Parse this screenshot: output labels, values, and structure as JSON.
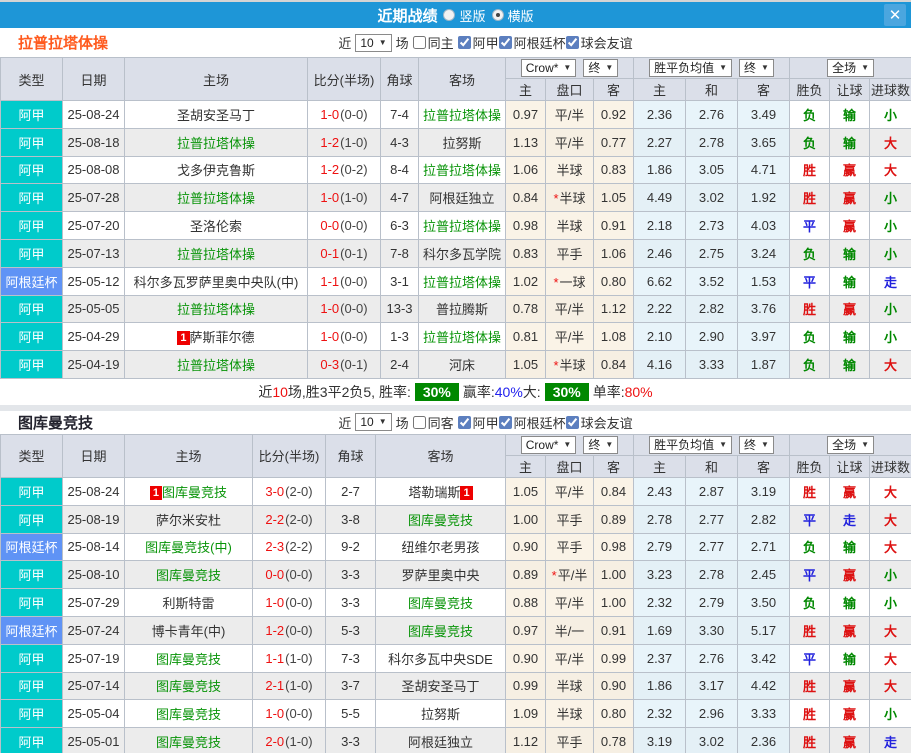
{
  "titlebar": {
    "title": "近期战绩",
    "vertical_label": "竖版",
    "horizontal_label": "横版",
    "horizontal_selected": true,
    "close_glyph": "✕",
    "bar_color": "#1e96d7"
  },
  "table_header": {
    "type": "类型",
    "date": "日期",
    "home": "主场",
    "score": "比分(半场)",
    "corners": "角球",
    "away": "客场",
    "crow_select": "Crow*",
    "final_select": "终",
    "avg_select": "胜平负均值",
    "full_select": "全场",
    "sub_home": "主",
    "sub_handicap": "盘口",
    "sub_away": "客",
    "sub_avg_home": "主",
    "sub_avg_draw": "和",
    "sub_avg_away": "客",
    "sub_result": "胜负",
    "sub_handicap_result": "让球",
    "sub_goals": "进球数"
  },
  "league_colors": {
    "阿甲": "#00cbcb",
    "阿根廷杯": "#5f93f5"
  },
  "sections": [
    {
      "team": "拉普拉塔体操",
      "title_color": "#ff5a1e",
      "filter": {
        "near": "近",
        "count": "10",
        "games": "场",
        "same_label": "同主",
        "same_checked": false,
        "leagues": [
          {
            "label": "阿甲",
            "checked": true
          },
          {
            "label": "阿根廷杯",
            "checked": true
          },
          {
            "label": "球会友谊",
            "checked": true
          }
        ]
      },
      "rows": [
        {
          "league": "阿甲",
          "date": "25-08-24",
          "home": {
            "name": "圣胡安圣马丁"
          },
          "score": "1-0",
          "half": "(0-0)",
          "corners": "7-4",
          "away": {
            "name": "拉普拉塔体操",
            "highlight": true
          },
          "crow": [
            "0.97",
            "平/半",
            "0.92"
          ],
          "crow_star": false,
          "avg": [
            "2.36",
            "2.76",
            "3.49"
          ],
          "results": [
            {
              "t": "负",
              "c": "#008800"
            },
            {
              "t": "输",
              "c": "#008800"
            },
            {
              "t": "小",
              "c": "#008800"
            }
          ]
        },
        {
          "league": "阿甲",
          "date": "25-08-18",
          "home": {
            "name": "拉普拉塔体操",
            "highlight": true
          },
          "score": "1-2",
          "half": "(1-0)",
          "corners": "4-3",
          "away": {
            "name": "拉努斯"
          },
          "crow": [
            "1.13",
            "平/半",
            "0.77"
          ],
          "crow_star": false,
          "avg": [
            "2.27",
            "2.78",
            "3.65"
          ],
          "results": [
            {
              "t": "负",
              "c": "#008800"
            },
            {
              "t": "输",
              "c": "#008800"
            },
            {
              "t": "大",
              "c": "#dd1111"
            }
          ]
        },
        {
          "league": "阿甲",
          "date": "25-08-08",
          "home": {
            "name": "戈多伊克鲁斯"
          },
          "score": "1-2",
          "half": "(0-2)",
          "corners": "8-4",
          "away": {
            "name": "拉普拉塔体操",
            "highlight": true
          },
          "crow": [
            "1.06",
            "半球",
            "0.83"
          ],
          "crow_star": false,
          "avg": [
            "1.86",
            "3.05",
            "4.71"
          ],
          "results": [
            {
              "t": "胜",
              "c": "#dd1111"
            },
            {
              "t": "赢",
              "c": "#dd1111"
            },
            {
              "t": "大",
              "c": "#dd1111"
            }
          ]
        },
        {
          "league": "阿甲",
          "date": "25-07-28",
          "home": {
            "name": "拉普拉塔体操",
            "highlight": true
          },
          "score": "1-0",
          "half": "(1-0)",
          "corners": "4-7",
          "away": {
            "name": "阿根廷独立"
          },
          "crow": [
            "0.84",
            "半球",
            "1.05"
          ],
          "crow_star": true,
          "avg": [
            "4.49",
            "3.02",
            "1.92"
          ],
          "results": [
            {
              "t": "胜",
              "c": "#dd1111"
            },
            {
              "t": "赢",
              "c": "#dd1111"
            },
            {
              "t": "小",
              "c": "#008800"
            }
          ]
        },
        {
          "league": "阿甲",
          "date": "25-07-20",
          "home": {
            "name": "圣洛伦索"
          },
          "score": "0-0",
          "half": "(0-0)",
          "corners": "6-3",
          "away": {
            "name": "拉普拉塔体操",
            "highlight": true
          },
          "crow": [
            "0.98",
            "半球",
            "0.91"
          ],
          "crow_star": false,
          "avg": [
            "2.18",
            "2.73",
            "4.03"
          ],
          "results": [
            {
              "t": "平",
              "c": "#2222dd"
            },
            {
              "t": "赢",
              "c": "#dd1111"
            },
            {
              "t": "小",
              "c": "#008800"
            }
          ]
        },
        {
          "league": "阿甲",
          "date": "25-07-13",
          "home": {
            "name": "拉普拉塔体操",
            "highlight": true
          },
          "score": "0-1",
          "half": "(0-1)",
          "corners": "7-8",
          "away": {
            "name": "科尔多瓦学院"
          },
          "crow": [
            "0.83",
            "平手",
            "1.06"
          ],
          "crow_star": false,
          "avg": [
            "2.46",
            "2.75",
            "3.24"
          ],
          "results": [
            {
              "t": "负",
              "c": "#008800"
            },
            {
              "t": "输",
              "c": "#008800"
            },
            {
              "t": "小",
              "c": "#008800"
            }
          ]
        },
        {
          "league": "阿根廷杯",
          "date": "25-05-12",
          "home": {
            "name": "科尔多瓦罗萨里奥中央队(中)"
          },
          "score": "1-1",
          "half": "(0-0)",
          "corners": "3-1",
          "away": {
            "name": "拉普拉塔体操",
            "highlight": true
          },
          "crow": [
            "1.02",
            "一球",
            "0.80"
          ],
          "crow_star": true,
          "avg": [
            "6.62",
            "3.52",
            "1.53"
          ],
          "results": [
            {
              "t": "平",
              "c": "#2222dd"
            },
            {
              "t": "输",
              "c": "#008800"
            },
            {
              "t": "走",
              "c": "#2222dd"
            }
          ]
        },
        {
          "league": "阿甲",
          "date": "25-05-05",
          "home": {
            "name": "拉普拉塔体操",
            "highlight": true
          },
          "score": "1-0",
          "half": "(0-0)",
          "corners": "13-3",
          "away": {
            "name": "普拉腾斯"
          },
          "crow": [
            "0.78",
            "平/半",
            "1.12"
          ],
          "crow_star": false,
          "avg": [
            "2.22",
            "2.82",
            "3.76"
          ],
          "results": [
            {
              "t": "胜",
              "c": "#dd1111"
            },
            {
              "t": "赢",
              "c": "#dd1111"
            },
            {
              "t": "小",
              "c": "#008800"
            }
          ]
        },
        {
          "league": "阿甲",
          "date": "25-04-29",
          "home": {
            "name": "萨斯菲尔德",
            "badge_before": "1"
          },
          "score": "1-0",
          "half": "(0-0)",
          "corners": "1-3",
          "away": {
            "name": "拉普拉塔体操",
            "highlight": true
          },
          "crow": [
            "0.81",
            "平/半",
            "1.08"
          ],
          "crow_star": false,
          "avg": [
            "2.10",
            "2.90",
            "3.97"
          ],
          "results": [
            {
              "t": "负",
              "c": "#008800"
            },
            {
              "t": "输",
              "c": "#008800"
            },
            {
              "t": "小",
              "c": "#008800"
            }
          ]
        },
        {
          "league": "阿甲",
          "date": "25-04-19",
          "home": {
            "name": "拉普拉塔体操",
            "highlight": true
          },
          "score": "0-3",
          "half": "(0-1)",
          "corners": "2-4",
          "away": {
            "name": "河床"
          },
          "crow": [
            "1.05",
            "半球",
            "0.84"
          ],
          "crow_star": true,
          "avg": [
            "4.16",
            "3.33",
            "1.87"
          ],
          "results": [
            {
              "t": "负",
              "c": "#008800"
            },
            {
              "t": "输",
              "c": "#008800"
            },
            {
              "t": "大",
              "c": "#dd1111"
            }
          ]
        }
      ],
      "summary": {
        "parts": [
          {
            "t": "近",
            "c": "#333333"
          },
          {
            "t": "10",
            "c": "#ee1111"
          },
          {
            "t": "场,胜3平2负5, 胜率: ",
            "c": "#333333"
          },
          {
            "t": "30%",
            "badge": true
          },
          {
            "t": " 赢率:",
            "c": "#333333"
          },
          {
            "t": "40%",
            "c": "#2222ee"
          },
          {
            "t": " 大: ",
            "c": "#333333"
          },
          {
            "t": "30%",
            "badge": true
          },
          {
            "t": " 单率:",
            "c": "#333333"
          },
          {
            "t": "80%",
            "c": "#ee1111"
          }
        ]
      }
    },
    {
      "team": "图库曼竞技",
      "title_color": "#23232e",
      "filter": {
        "near": "近",
        "count": "10",
        "games": "场",
        "same_label": "同客",
        "same_checked": false,
        "leagues": [
          {
            "label": "阿甲",
            "checked": true
          },
          {
            "label": "阿根廷杯",
            "checked": true
          },
          {
            "label": "球会友谊",
            "checked": true
          }
        ]
      },
      "rows": [
        {
          "league": "阿甲",
          "date": "25-08-24",
          "home": {
            "name": "图库曼竞技",
            "highlight": true,
            "badge_before": "1"
          },
          "score": "3-0",
          "half": "(2-0)",
          "corners": "2-7",
          "away": {
            "name": "塔勒瑞斯",
            "badge_after": "1"
          },
          "crow": [
            "1.05",
            "平/半",
            "0.84"
          ],
          "crow_star": false,
          "avg": [
            "2.43",
            "2.87",
            "3.19"
          ],
          "results": [
            {
              "t": "胜",
              "c": "#dd1111"
            },
            {
              "t": "赢",
              "c": "#dd1111"
            },
            {
              "t": "大",
              "c": "#dd1111"
            }
          ]
        },
        {
          "league": "阿甲",
          "date": "25-08-19",
          "home": {
            "name": "萨尔米安杜"
          },
          "score": "2-2",
          "half": "(2-0)",
          "corners": "3-8",
          "away": {
            "name": "图库曼竞技",
            "highlight": true
          },
          "crow": [
            "1.00",
            "平手",
            "0.89"
          ],
          "crow_star": false,
          "avg": [
            "2.78",
            "2.77",
            "2.82"
          ],
          "results": [
            {
              "t": "平",
              "c": "#2222dd"
            },
            {
              "t": "走",
              "c": "#2222dd"
            },
            {
              "t": "大",
              "c": "#dd1111"
            }
          ]
        },
        {
          "league": "阿根廷杯",
          "date": "25-08-14",
          "home": {
            "name": "图库曼竞技(中)",
            "highlight": true
          },
          "score": "2-3",
          "half": "(2-2)",
          "corners": "9-2",
          "away": {
            "name": "纽维尔老男孩"
          },
          "crow": [
            "0.90",
            "平手",
            "0.98"
          ],
          "crow_star": false,
          "avg": [
            "2.79",
            "2.77",
            "2.71"
          ],
          "results": [
            {
              "t": "负",
              "c": "#008800"
            },
            {
              "t": "输",
              "c": "#008800"
            },
            {
              "t": "大",
              "c": "#dd1111"
            }
          ]
        },
        {
          "league": "阿甲",
          "date": "25-08-10",
          "home": {
            "name": "图库曼竞技",
            "highlight": true
          },
          "score": "0-0",
          "half": "(0-0)",
          "corners": "3-3",
          "away": {
            "name": "罗萨里奥中央"
          },
          "crow": [
            "0.89",
            "平/半",
            "1.00"
          ],
          "crow_star": true,
          "avg": [
            "3.23",
            "2.78",
            "2.45"
          ],
          "results": [
            {
              "t": "平",
              "c": "#2222dd"
            },
            {
              "t": "赢",
              "c": "#dd1111"
            },
            {
              "t": "小",
              "c": "#008800"
            }
          ]
        },
        {
          "league": "阿甲",
          "date": "25-07-29",
          "home": {
            "name": "利斯特雷"
          },
          "score": "1-0",
          "half": "(0-0)",
          "corners": "3-3",
          "away": {
            "name": "图库曼竞技",
            "highlight": true
          },
          "crow": [
            "0.88",
            "平/半",
            "1.00"
          ],
          "crow_star": false,
          "avg": [
            "2.32",
            "2.79",
            "3.50"
          ],
          "results": [
            {
              "t": "负",
              "c": "#008800"
            },
            {
              "t": "输",
              "c": "#008800"
            },
            {
              "t": "小",
              "c": "#008800"
            }
          ]
        },
        {
          "league": "阿根廷杯",
          "date": "25-07-24",
          "home": {
            "name": "博卡青年(中)"
          },
          "score": "1-2",
          "half": "(0-0)",
          "corners": "5-3",
          "away": {
            "name": "图库曼竞技",
            "highlight": true
          },
          "crow": [
            "0.97",
            "半/一",
            "0.91"
          ],
          "crow_star": false,
          "avg": [
            "1.69",
            "3.30",
            "5.17"
          ],
          "results": [
            {
              "t": "胜",
              "c": "#dd1111"
            },
            {
              "t": "赢",
              "c": "#dd1111"
            },
            {
              "t": "大",
              "c": "#dd1111"
            }
          ]
        },
        {
          "league": "阿甲",
          "date": "25-07-19",
          "home": {
            "name": "图库曼竞技",
            "highlight": true
          },
          "score": "1-1",
          "half": "(1-0)",
          "corners": "7-3",
          "away": {
            "name": "科尔多瓦中央SDE"
          },
          "crow": [
            "0.90",
            "平/半",
            "0.99"
          ],
          "crow_star": false,
          "avg": [
            "2.37",
            "2.76",
            "3.42"
          ],
          "results": [
            {
              "t": "平",
              "c": "#2222dd"
            },
            {
              "t": "输",
              "c": "#008800"
            },
            {
              "t": "大",
              "c": "#dd1111"
            }
          ]
        },
        {
          "league": "阿甲",
          "date": "25-07-14",
          "home": {
            "name": "图库曼竞技",
            "highlight": true
          },
          "score": "2-1",
          "half": "(1-0)",
          "corners": "3-7",
          "away": {
            "name": "圣胡安圣马丁"
          },
          "crow": [
            "0.99",
            "半球",
            "0.90"
          ],
          "crow_star": false,
          "avg": [
            "1.86",
            "3.17",
            "4.42"
          ],
          "results": [
            {
              "t": "胜",
              "c": "#dd1111"
            },
            {
              "t": "赢",
              "c": "#dd1111"
            },
            {
              "t": "大",
              "c": "#dd1111"
            }
          ]
        },
        {
          "league": "阿甲",
          "date": "25-05-04",
          "home": {
            "name": "图库曼竞技",
            "highlight": true
          },
          "score": "1-0",
          "half": "(0-0)",
          "corners": "5-5",
          "away": {
            "name": "拉努斯"
          },
          "crow": [
            "1.09",
            "半球",
            "0.80"
          ],
          "crow_star": false,
          "avg": [
            "2.32",
            "2.96",
            "3.33"
          ],
          "results": [
            {
              "t": "胜",
              "c": "#dd1111"
            },
            {
              "t": "赢",
              "c": "#dd1111"
            },
            {
              "t": "小",
              "c": "#008800"
            }
          ]
        },
        {
          "league": "阿甲",
          "date": "25-05-01",
          "home": {
            "name": "图库曼竞技",
            "highlight": true
          },
          "score": "2-0",
          "half": "(1-0)",
          "corners": "3-3",
          "away": {
            "name": "阿根廷独立"
          },
          "crow": [
            "1.12",
            "平手",
            "0.78"
          ],
          "crow_star": false,
          "avg": [
            "3.19",
            "3.02",
            "2.36"
          ],
          "results": [
            {
              "t": "胜",
              "c": "#dd1111"
            },
            {
              "t": "赢",
              "c": "#dd1111"
            },
            {
              "t": "走",
              "c": "#2222dd"
            }
          ]
        }
      ],
      "summary": null
    }
  ]
}
